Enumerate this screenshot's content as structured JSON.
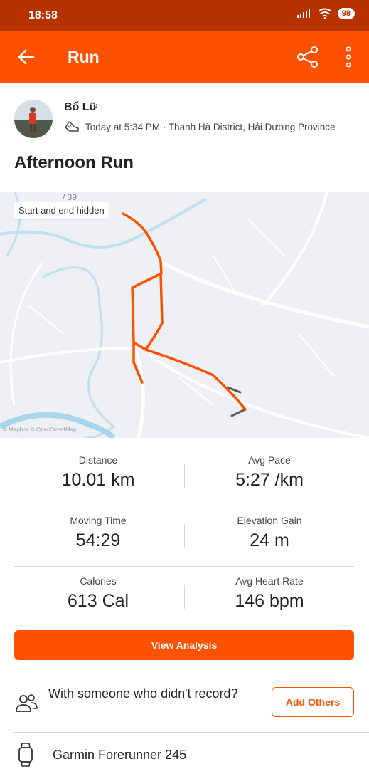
{
  "status_bar": {
    "time": "18:58",
    "battery": "98"
  },
  "app_bar": {
    "title": "Run"
  },
  "activity": {
    "athlete_name": "Bố Lữ",
    "meta": "Today at 5:34 PM · Thanh Hà District, Hải Dương Province",
    "title": "Afternoon Run"
  },
  "map": {
    "badge": "Start and end hidden",
    "attribution": "© Mapbox © OpenStreetMap",
    "route_color": "#fc5200"
  },
  "stats": [
    {
      "label": "Distance",
      "value": "10.01 km"
    },
    {
      "label": "Avg Pace",
      "value": "5:27 /km"
    },
    {
      "label": "Moving Time",
      "value": "54:29"
    },
    {
      "label": "Elevation Gain",
      "value": "24 m"
    },
    {
      "label": "Calories",
      "value": "613 Cal"
    },
    {
      "label": "Avg Heart Rate",
      "value": "146 bpm"
    }
  ],
  "actions": {
    "view_analysis": "View Analysis",
    "with_someone": "With someone who didn't record?",
    "add_others": "Add Others"
  },
  "device": {
    "name": "Garmin Forerunner 245"
  },
  "colors": {
    "brand": "#fc5200",
    "status_bar": "#b83200"
  }
}
